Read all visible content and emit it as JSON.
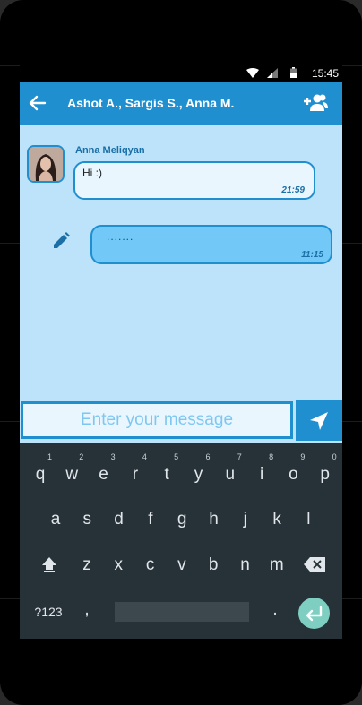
{
  "status_bar": {
    "time": "15:45"
  },
  "app_bar": {
    "title": "Ashot A., Sargis S., Anna M."
  },
  "messages": [
    {
      "sender": "Anna Meliqyan",
      "text": "Hi :)",
      "time": "21:59"
    },
    {
      "text": ".......",
      "time": "11:15"
    }
  ],
  "compose": {
    "placeholder": "Enter your message"
  },
  "keyboard": {
    "row1": [
      {
        "key": "q",
        "hint": "1"
      },
      {
        "key": "w",
        "hint": "2"
      },
      {
        "key": "e",
        "hint": "3"
      },
      {
        "key": "r",
        "hint": "4"
      },
      {
        "key": "t",
        "hint": "5"
      },
      {
        "key": "y",
        "hint": "6"
      },
      {
        "key": "u",
        "hint": "7"
      },
      {
        "key": "i",
        "hint": "8"
      },
      {
        "key": "o",
        "hint": "9"
      },
      {
        "key": "p",
        "hint": "0"
      }
    ],
    "row2": [
      "a",
      "s",
      "d",
      "f",
      "g",
      "h",
      "j",
      "k",
      "l"
    ],
    "row3": [
      "z",
      "x",
      "c",
      "v",
      "b",
      "n",
      "m"
    ],
    "symbols_label": "?123",
    "comma": ",",
    "period": "."
  },
  "colors": {
    "accent": "#1f8fd0",
    "chat_bg": "#bde3fb",
    "keyboard_bg": "#263238",
    "enter_key": "#7ecfc1"
  }
}
